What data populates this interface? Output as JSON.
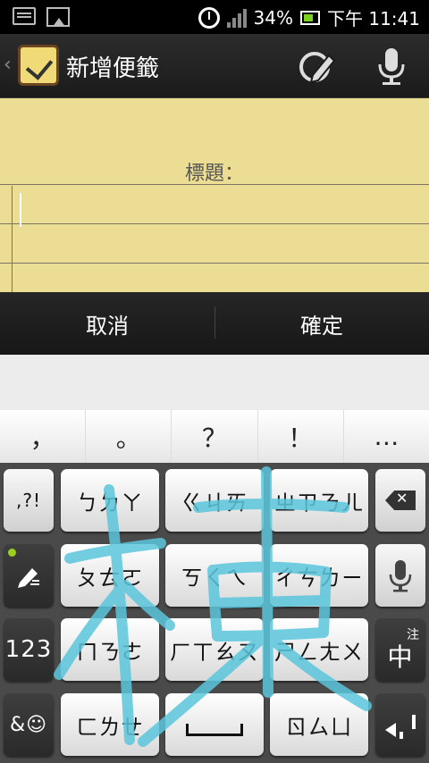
{
  "status_bar": {
    "battery_percent": "34%",
    "time": "下午 11:41",
    "icons": [
      "keyboard-icon",
      "image-icon",
      "alarm-icon",
      "signal-icon",
      "battery-icon"
    ]
  },
  "action_bar": {
    "title": "新增便籤",
    "icons": [
      "app-notepad-icon",
      "pen-icon",
      "microphone-icon"
    ]
  },
  "note": {
    "title_label": "標題："
  },
  "buttons": {
    "cancel": "取消",
    "confirm": "確定"
  },
  "keyboard": {
    "punctuation": [
      "，",
      "。",
      "？",
      "！",
      "…"
    ],
    "row1": {
      "symbols": ",?!",
      "keys": [
        "ㄅㄉㄚ",
        "ㄍㄐㄞ",
        "ㄓㄗㄋㄦ"
      ]
    },
    "row2": {
      "keys": [
        "ㄆㄊㄛ",
        "ㄎㄑㄟ",
        "ㄔㄘㄌㄧ"
      ]
    },
    "row3": {
      "num": "123",
      "keys": [
        "ㄇㄋㄜ",
        "ㄏㄒㄠㄡ",
        "ㄕㄥㄤㄨ"
      ],
      "mode_top": "注",
      "mode_main": "中"
    },
    "row4": {
      "emoji": "&☺",
      "keys": [
        "ㄈㄌㄝ",
        "ㄖㄙㄩ"
      ]
    }
  },
  "colors": {
    "note_paper": "#ecdd94",
    "handwriting_stroke": "#5bc6dc"
  }
}
